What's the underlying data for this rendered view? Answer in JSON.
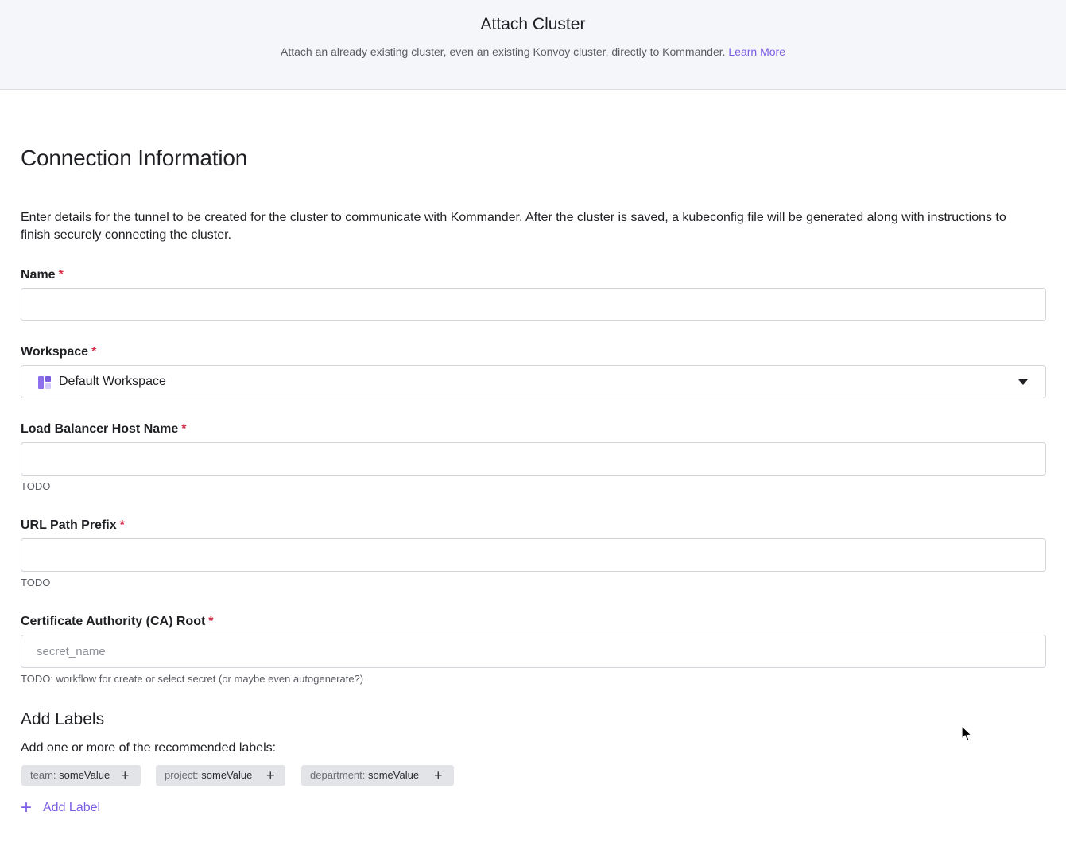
{
  "header": {
    "title": "Attach Cluster",
    "subtitle": "Attach an already existing cluster, even an existing Konvoy cluster, directly to Kommander.",
    "learn_more": "Learn More"
  },
  "section": {
    "title": "Connection Information",
    "description": "Enter details for the tunnel to be created for the cluster to communicate with Kommander. After the cluster is saved, a kubeconfig file will be generated along with instructions to finish securely connecting the cluster."
  },
  "required_marker": "*",
  "fields": {
    "name": {
      "label": "Name",
      "value": "",
      "placeholder": ""
    },
    "workspace": {
      "label": "Workspace",
      "selected": "Default Workspace",
      "icon": "workspace-icon"
    },
    "load_balancer": {
      "label": "Load Balancer Host Name",
      "value": "",
      "placeholder": "",
      "helper": "TODO"
    },
    "url_prefix": {
      "label": "URL Path Prefix",
      "value": "",
      "placeholder": "",
      "helper": "TODO"
    },
    "ca_root": {
      "label": "Certificate Authority (CA) Root",
      "value": "",
      "placeholder": "secret_name",
      "helper": "TODO: workflow for create or select secret (or maybe even autogenerate?)"
    }
  },
  "labels": {
    "title": "Add Labels",
    "subtitle": "Add one or more of the recommended labels:",
    "chips": [
      {
        "key": "team:",
        "value": "someValue"
      },
      {
        "key": "project:",
        "value": "someValue"
      },
      {
        "key": "department:",
        "value": "someValue"
      }
    ],
    "add_label": "Add Label"
  },
  "colors": {
    "accent": "#7b5ce5",
    "required": "#d6304a",
    "header_bg": "#f5f6f9",
    "chip_bg": "#e3e4e8"
  }
}
